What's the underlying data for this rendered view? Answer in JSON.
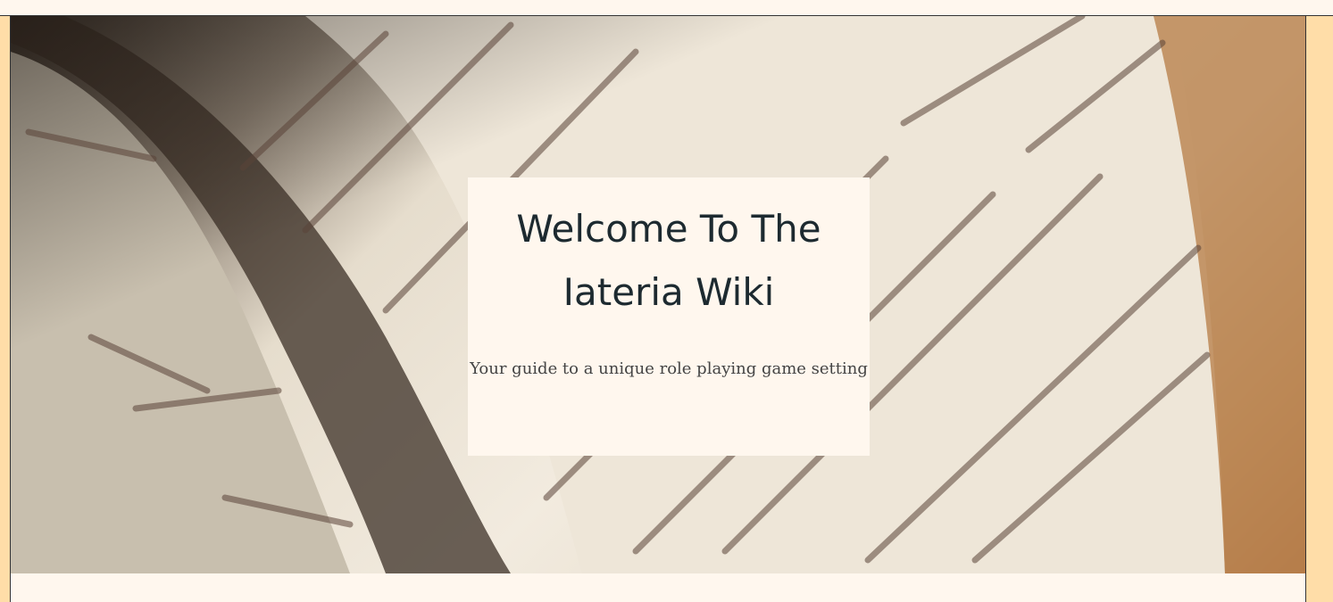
{
  "hero": {
    "title": "Welcome To The Iateria Wiki",
    "subtitle": "Your guide to a unique role playing game setting"
  },
  "background_image": {
    "description_icon": "old-book-pages-image"
  },
  "colors": {
    "page_background": "#ffdda8",
    "card_background": "#fff7ee",
    "title_color": "#1d2a30"
  }
}
